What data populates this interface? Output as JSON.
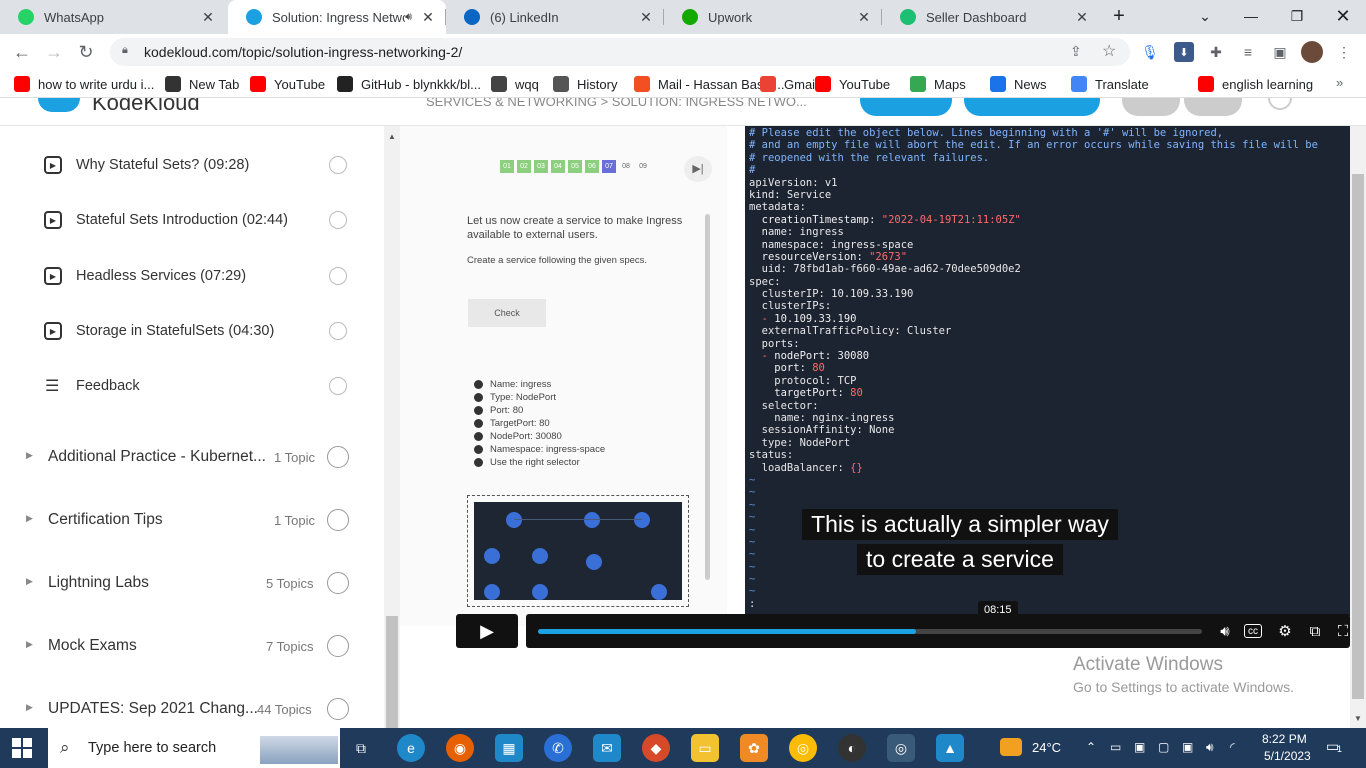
{
  "tabs": [
    {
      "title": "WhatsApp",
      "icon": "whatsapp-icon",
      "color": "#25d366",
      "active": false
    },
    {
      "title": "Solution: Ingress Networ",
      "icon": "kodekloud-icon",
      "color": "#1ba1e2",
      "active": true
    },
    {
      "title": "(6) LinkedIn",
      "icon": "linkedin-icon",
      "color": "#0a66c2",
      "active": false
    },
    {
      "title": "Upwork",
      "icon": "upwork-icon",
      "color": "#14a800",
      "active": false
    },
    {
      "title": "Seller Dashboard",
      "icon": "fiverr-icon",
      "color": "#1dbf73",
      "active": false
    }
  ],
  "address": {
    "url": "kodekloud.com/topic/solution-ingress-networking-2/"
  },
  "bookmarks": [
    {
      "label": "how to write urdu i...",
      "icon": "youtube-icon"
    },
    {
      "label": "New Tab",
      "icon": "globe-icon"
    },
    {
      "label": "YouTube",
      "icon": "youtube-icon"
    },
    {
      "label": "GitHub - blynkkk/bl...",
      "icon": "github-icon"
    },
    {
      "label": "wqq",
      "icon": "download-icon"
    },
    {
      "label": "History",
      "icon": "history-icon"
    },
    {
      "label": "Mail - Hassan Bashi...",
      "icon": "outlook-icon"
    },
    {
      "label": "Gmail",
      "icon": "gmail-icon"
    },
    {
      "label": "YouTube",
      "icon": "youtube-icon"
    },
    {
      "label": "Maps",
      "icon": "maps-icon"
    },
    {
      "label": "News",
      "icon": "news-icon"
    },
    {
      "label": "Translate",
      "icon": "translate-icon"
    },
    {
      "label": "english learning",
      "icon": "youtube-icon"
    }
  ],
  "header": {
    "logo": "KodeKloud",
    "breadcrumb": "SERVICES & NETWORKING > SOLUTION: INGRESS NETWO..."
  },
  "sidebar": {
    "lessons": [
      {
        "label": "Why Stateful Sets? (09:28)"
      },
      {
        "label": "Stateful Sets Introduction (02:44)"
      },
      {
        "label": "Headless Services (07:29)"
      },
      {
        "label": "Storage in StatefulSets (04:30)"
      },
      {
        "label": "Feedback"
      }
    ],
    "sections": [
      {
        "label": "Additional Practice - Kubernet...",
        "count": "1 Topic"
      },
      {
        "label": "Certification Tips",
        "count": "1 Topic"
      },
      {
        "label": "Lightning Labs",
        "count": "5 Topics"
      },
      {
        "label": "Mock Exams",
        "count": "7 Topics"
      },
      {
        "label": "UPDATES: Sep 2021 Chang...",
        "count": "44 Topics"
      }
    ]
  },
  "slide": {
    "steps": [
      "01",
      "02",
      "03",
      "04",
      "05",
      "06",
      "07",
      "08",
      "09"
    ],
    "intro": "Let us now create a service to make Ingress available to external users.",
    "instruction": "Create a service following the given specs.",
    "check": "Check",
    "specs": [
      "Name: ingress",
      "Type: NodePort",
      "Port: 80",
      "TargetPort: 80",
      "NodePort: 30080",
      "Namespace: ingress-space",
      "Use the right selector"
    ]
  },
  "terminal": {
    "lines": [
      "# Please edit the object below. Lines beginning with a '#' will be ignored,",
      "# and an empty file will abort the edit. If an error occurs while saving this file will be",
      "# reopened with the relevant failures.",
      "#",
      "apiVersion: v1",
      "kind: Service",
      "metadata:",
      "  creationTimestamp: \"2022-04-19T21:11:05Z\"",
      "  name: ingress",
      "  namespace: ingress-space",
      "  resourceVersion: \"2673\"",
      "  uid: 78fbd1ab-f660-49ae-ad62-70dee509d0e2",
      "spec:",
      "  clusterIP: 10.109.33.190",
      "  clusterIPs:",
      "  - 10.109.33.190",
      "  externalTrafficPolicy: Cluster",
      "  ports:",
      "  - nodePort: 30080",
      "    port: 80",
      "    protocol: TCP",
      "    targetPort: 80",
      "  selector:",
      "    name: nginx-ingress",
      "  sessionAffinity: None",
      "  type: NodePort",
      "status:",
      "  loadBalancer: {}",
      "~",
      "~",
      "~",
      "~",
      "~",
      "~",
      "~",
      "~",
      "~",
      "~",
      ":"
    ]
  },
  "caption": {
    "line1": "This is actually a simpler way",
    "line2": "to create a service"
  },
  "player": {
    "time": "08:15",
    "progress": 0.57
  },
  "watermark": {
    "title": "Activate Windows",
    "subtitle": "Go to Settings to activate Windows."
  },
  "taskbar": {
    "search_placeholder": "Type here to search",
    "weather": "24°C",
    "time": "8:22 PM",
    "date": "5/1/2023",
    "notifications": "1"
  }
}
